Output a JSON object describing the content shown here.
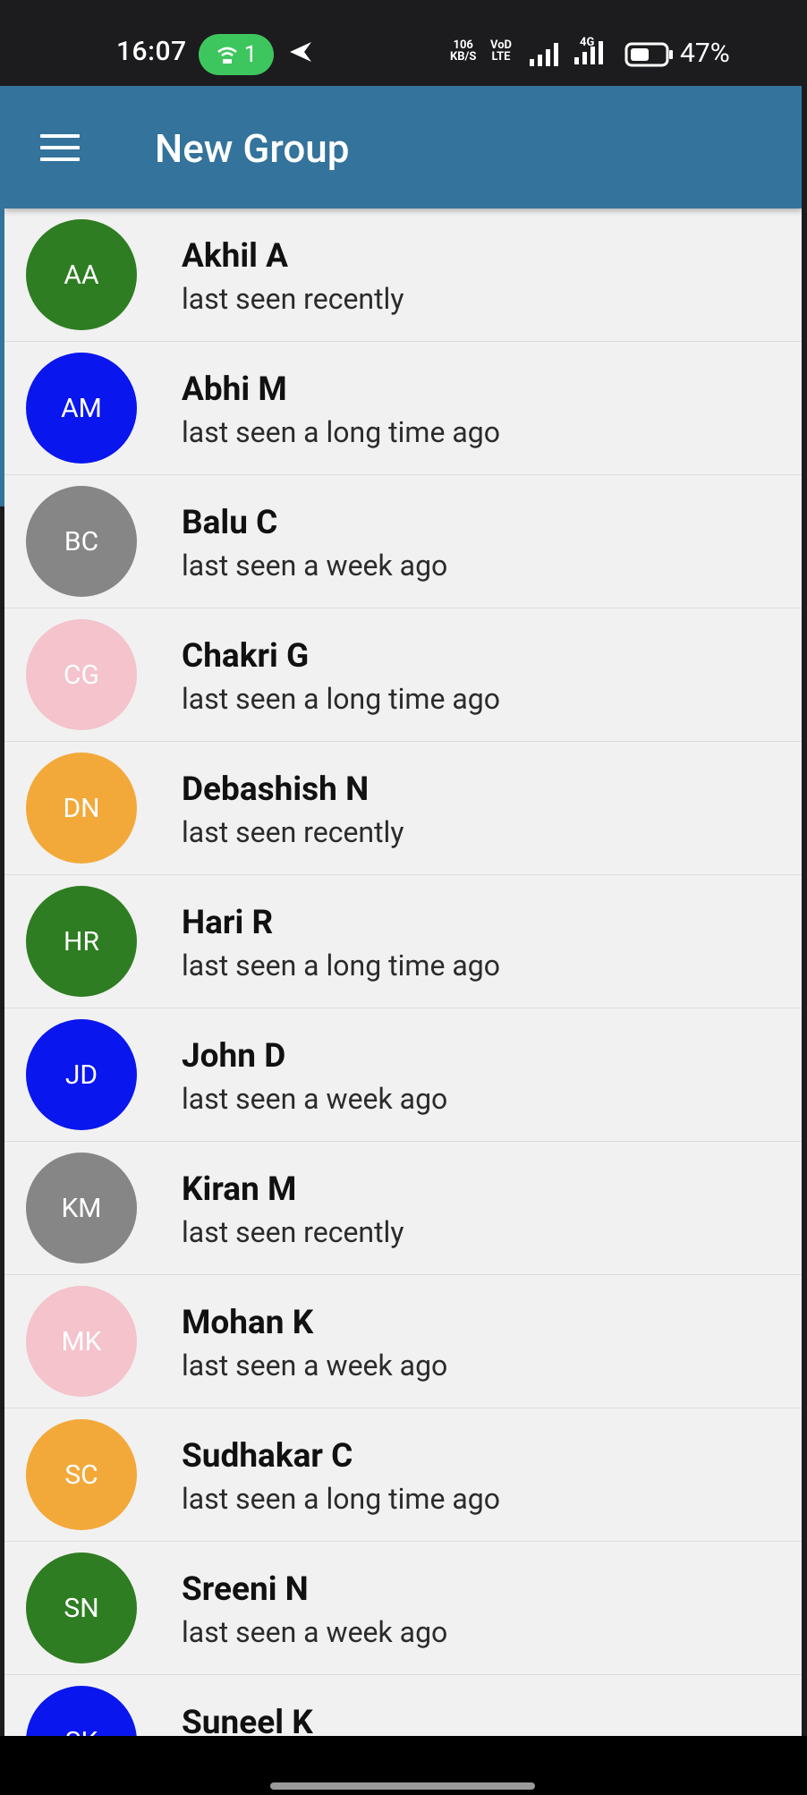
{
  "status_bar": {
    "time": "16:07",
    "hotspot_count": "1",
    "net_speed_value": "106",
    "net_speed_unit": "KB/S",
    "volte_top": "VoD",
    "volte_bottom": "LTE",
    "network_type": "4G",
    "battery_percent": "47%"
  },
  "app_bar": {
    "title": "New Group",
    "menu_icon": "hamburger-menu-icon"
  },
  "contacts": [
    {
      "initials": "AA",
      "name": "Akhil A",
      "status": "last seen recently",
      "color": "#2f7d22"
    },
    {
      "initials": "AM",
      "name": "Abhi M",
      "status": "last seen a long time ago",
      "color": "#0a16ee"
    },
    {
      "initials": "BC",
      "name": "Balu C",
      "status": "last seen a week ago",
      "color": "#868686"
    },
    {
      "initials": "CG",
      "name": "Chakri G",
      "status": "last seen a long time ago",
      "color": "#f4c3cc"
    },
    {
      "initials": "DN",
      "name": "Debashish N",
      "status": "last seen recently",
      "color": "#f3a93a"
    },
    {
      "initials": "HR",
      "name": "Hari R",
      "status": "last seen a long time ago",
      "color": "#2f7d22"
    },
    {
      "initials": "JD",
      "name": "John D",
      "status": "last seen a week ago",
      "color": "#0a16ee"
    },
    {
      "initials": "KM",
      "name": "Kiran M",
      "status": "last seen recently",
      "color": "#868686"
    },
    {
      "initials": "MK",
      "name": "Mohan K",
      "status": "last seen a week ago",
      "color": "#f4c3cc"
    },
    {
      "initials": "SC",
      "name": "Sudhakar C",
      "status": "last seen a long time ago",
      "color": "#f3a93a"
    },
    {
      "initials": "SN",
      "name": "Sreeni N",
      "status": "last seen a week ago",
      "color": "#2f7d22"
    },
    {
      "initials": "SK",
      "name": "Suneel K",
      "status": "",
      "color": "#0a16ee"
    }
  ]
}
